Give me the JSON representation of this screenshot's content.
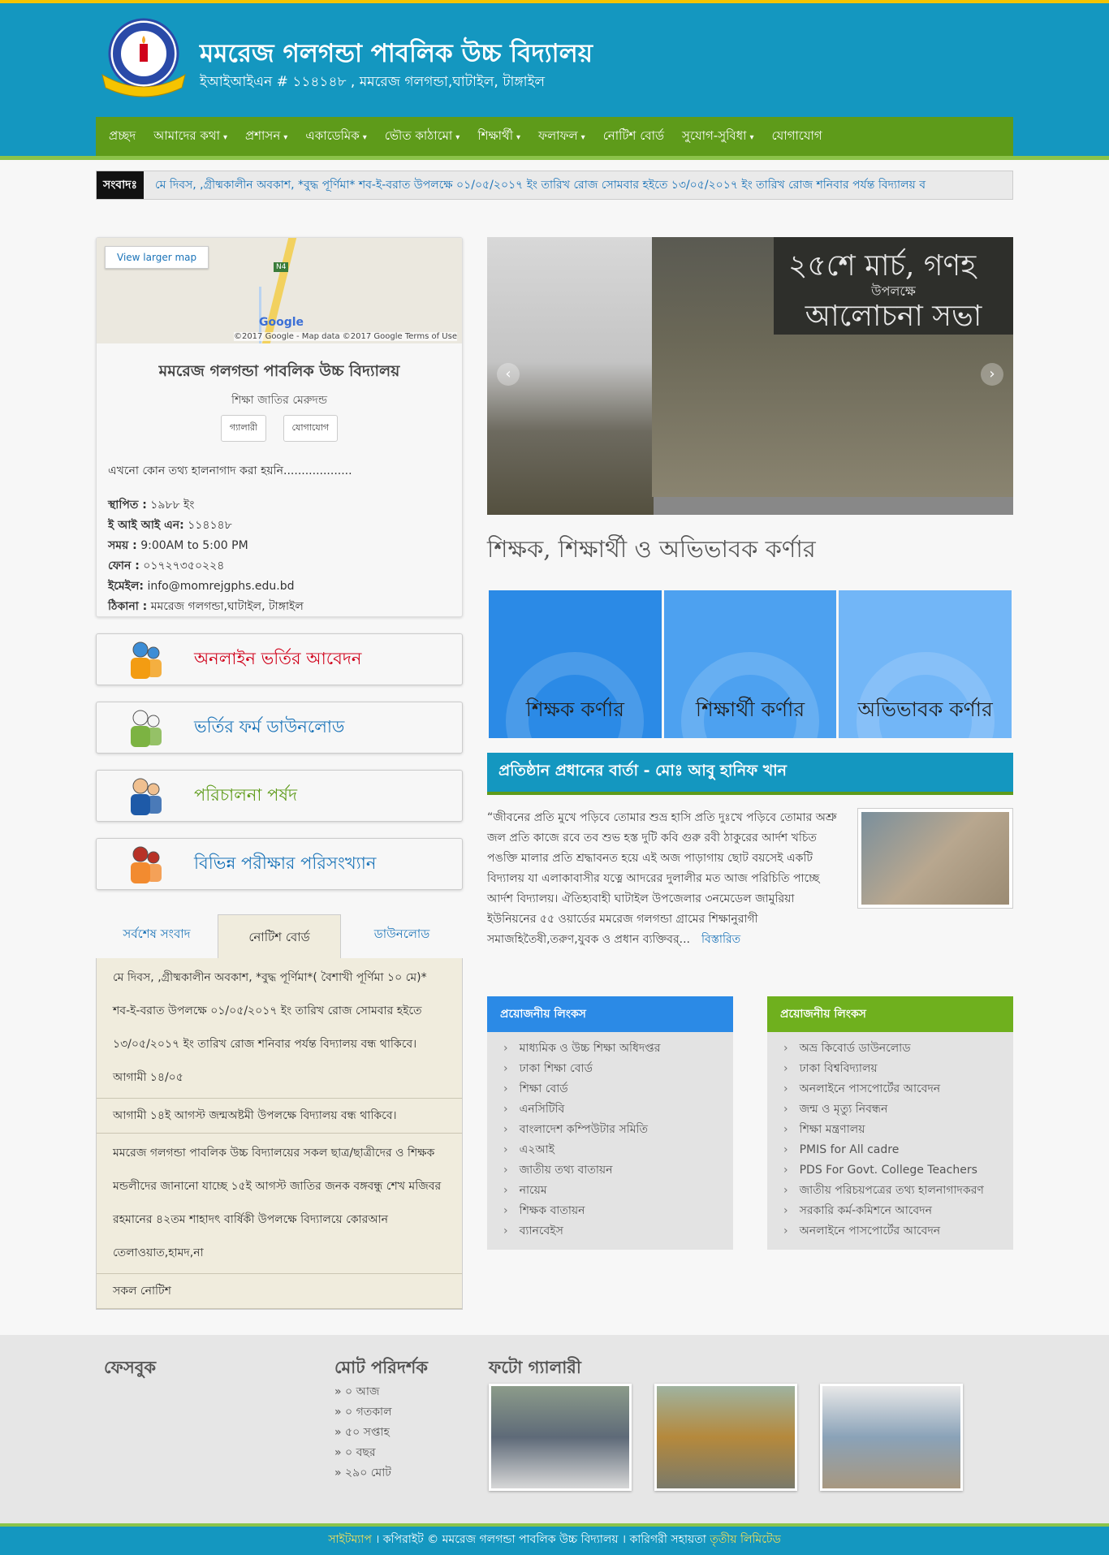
{
  "header": {
    "title": "মমরেজ গলগন্ডা পাবলিক উচ্চ বিদ্যালয়",
    "subtitle": "ইআইআইএন # ১১৪১৪৮ , মমরেজ গলগন্ডা,ঘাটাইল, টাঙ্গাইল"
  },
  "nav": [
    "প্রচ্ছদ",
    "আমাদের কথা",
    "প্রশাসন",
    "একাডেমিক",
    "ভৌত কাঠামো",
    "শিক্ষার্থী",
    "ফলাফল",
    "নোটিশ বোর্ড",
    "সুযোগ-সুবিধা",
    "যোগাযোগ"
  ],
  "nav_dropdown": [
    false,
    true,
    true,
    true,
    true,
    true,
    true,
    false,
    true,
    false
  ],
  "ticker": {
    "label": "সংবাদঃ",
    "text": "মে দিবস, ,গ্রীষ্মকালীন অবকাশ, *বুদ্ধ পূর্ণিমা* শব-ই-বরাত উপলক্ষে ০১/০৫/২০১৭ ইং তারিখ রোজ সোমবার হইতে ১৩/০৫/২০১৭ ইং তারিখ রোজ শনিবার পর্যন্ত বিদ্যালয় ব"
  },
  "map": {
    "button": "View larger map",
    "road_label": "N4",
    "logo": "Google",
    "footer": "©2017 Google - Map data ©2017 Google   Terms of Use"
  },
  "info": {
    "name": "মমরেজ গলগন্ডা পাবলিক উচ্চ বিদ্যালয়",
    "motto": "শিক্ষা জাতির মেরুদন্ড",
    "btn_gallery": "গ্যালারী",
    "btn_contact": "যোগাযোগ",
    "note": "এখনো কোন তথ্য হালনাগাদ করা হয়নি...................",
    "established_label": "স্থাপিত :",
    "established": "১৯৮৮ ইং",
    "eiin_label": "ই আই আই এন:",
    "eiin": "১১৪১৪৮",
    "time_label": "সময় :",
    "time": "9:00AM to 5:00 PM",
    "phone_label": "ফোন :",
    "phone": "০১৭২৭৩৫০২২৪",
    "email_label": "ইমেইল:",
    "email": "info@momrejgphs.edu.bd",
    "address_label": "ঠিকানা :",
    "address": "মমরেজ গলগন্ডা,ঘাটাইল, টাঙ্গাইল"
  },
  "quick_links": [
    {
      "label": "অনলাইন ভর্তির আবেদন",
      "color": "#d0021b"
    },
    {
      "label": "ভর্তির ফর্ম ডাউনলোড",
      "color": "#1a73b8"
    },
    {
      "label": "পরিচালনা পর্ষদ",
      "color": "#5e9b1a"
    },
    {
      "label": "বিভিন্ন পরীক্ষার পরিসংখ্যান",
      "color": "#1a73b8"
    }
  ],
  "tabs": [
    "সর্বশেষ সংবাদ",
    "নোটিশ বোর্ড",
    "ডাউনলোড"
  ],
  "notices": [
    "মে দিবস, ,গ্রীষ্মকালীন অবকাশ, *বুদ্ধ পূর্ণিমা*( বৈশাখী পূর্ণিমা ১০ মে)* শব-ই-বরাত উপলক্ষে ০১/০৫/২০১৭ ইং তারিখ রোজ সোমবার হইতে ১৩/০৫/২০১৭ ইং তারিখ রোজ শনিবার পর্যন্ত বিদ্যালয় বন্ধ থাকিবে। আগামী ১৪/০৫",
    "আগামী ১৪ই আগস্ট জন্মঅষ্টমী উপলক্ষে বিদ্যালয় বন্ধ থাকিবে।",
    "মমরেজ গলগন্ডা পাবলিক উচ্চ বিদ্যালয়ের সকল ছাত্র/ছাত্রীদের ও শিক্ষক মন্ডলীদের জানানো যাচ্ছে ১৫ই আগস্ট জাতির জনক বঙ্গবন্ধু শেখ মজিবর রহমানের ৪২তম শাহাদৎ বার্ষিকী উপলক্ষে বিদ্যালয়ে কোরআন তেলাওয়াত,হামদ,না",
    "সকল নোটিশ"
  ],
  "slider": {
    "board_line1": "২৫শে মার্চ, গণহ",
    "board_line2": "উপলক্ষে",
    "board_line3": "আলোচনা সভা"
  },
  "corner": {
    "title": "শিক্ষক, শিক্ষার্থী ও অভিভাবক কর্ণার",
    "items": [
      {
        "label": "শিক্ষক কর্ণার",
        "color": "#2b8ae6"
      },
      {
        "label": "শিক্ষার্থী কর্ণার",
        "color": "#4da1f0"
      },
      {
        "label": "অভিভাবক কর্ণার",
        "color": "#72b6f7"
      }
    ]
  },
  "head_message": {
    "title": "প্রতিষ্ঠান প্রধানের বার্তা - মোঃ আবু হানিফ খান",
    "body": "“জীবনের প্রতি মুখে পড়িবে তোমার শুভ্র হাসি প্রতি দুঃখে পড়িবে তোমার অশ্রু জল প্রতি কাজে রবে তব শুভ হস্ত দুটি কবি গুরু রবী ঠাকুরের আর্দশ খচিত পঙক্তি মালার প্রতি শ্রদ্ধাবনত হয়ে এই অজ পাড়াগায় ছোট বয়সেই একটি বিদ্যালয় যা এলাকাবাসীর যত্নে আদরের দুলালীর মত আজ পরিচিতি পাচ্ছে আর্দশ বিদ্যালয়। ঐতিহ্যবাহী ঘাটাইল উপজেলার ৩নমেডেল জামুরিয়া ইউনিয়নের ৫৫ ওয়ার্ডের মমরেজ গলগন্ডা গ্রামের শিক্ষানুরাগী সমাজহিতৈষী,তরুণ,যুবক ও প্রধান ব্যক্তিবর্...",
    "more": "বিস্তারিত"
  },
  "links_left": {
    "title": "প্রয়োজনীয় লিংকস",
    "color": "#2b8ae6",
    "items": [
      "মাধ্যমিক ও উচ্চ শিক্ষা অধিদপ্তর",
      "ঢাকা শিক্ষা বোর্ড",
      "শিক্ষা বোর্ড",
      "এনসিটিবি",
      "বাংলাদেশ কম্পিউটার সমিতি",
      "এ২আই",
      "জাতীয় তথ্য বাতায়ন",
      "নায়েম",
      "শিক্ষক বাতায়ন",
      "ব্যানবেইস"
    ]
  },
  "links_right": {
    "title": "প্রয়োজনীয় লিংকস",
    "color": "#6fb01e",
    "items": [
      "অভ্র কিবোর্ড ডাউনলোড",
      "ঢাকা বিশ্ববিদ্যালয়",
      "অনলাইনে পাসপোর্টের আবেদন",
      "জন্ম ও মৃত্যু নিবন্ধন",
      "শিক্ষা মন্ত্রণালয়",
      "PMIS for All cadre",
      "PDS For Govt. College Teachers",
      "জাতীয় পরিচয়পত্রের তথ্য হালনাগাদকরণ",
      "সরকারি কর্ম-কমিশনে আবেদন",
      "অনলাইনে পাসপোর্টের আবেদন"
    ]
  },
  "footer": {
    "facebook": "ফেসবুক",
    "visitors_title": "মোট পরিদর্শক",
    "visitors": [
      "০ আজ",
      "০ গতকাল",
      "৫০ সপ্তাহ",
      "০ বছর",
      "২৯০ মোট"
    ],
    "gallery_title": "ফটো গ্যালারী",
    "sitemap": "সাইটম্যাপ",
    "copyright": " । কপিরাইট © মমরেজ গলগন্ডা পাবলিক উচ্চ বিদ্যালয় । কারিগরী সহায়তা ",
    "vendor": "তৃতীয় লিমিটেড"
  },
  "colors": {
    "primary": "#1497c0",
    "nav_green": "#5e9b1a",
    "accent_yellow": "#f5c400"
  }
}
